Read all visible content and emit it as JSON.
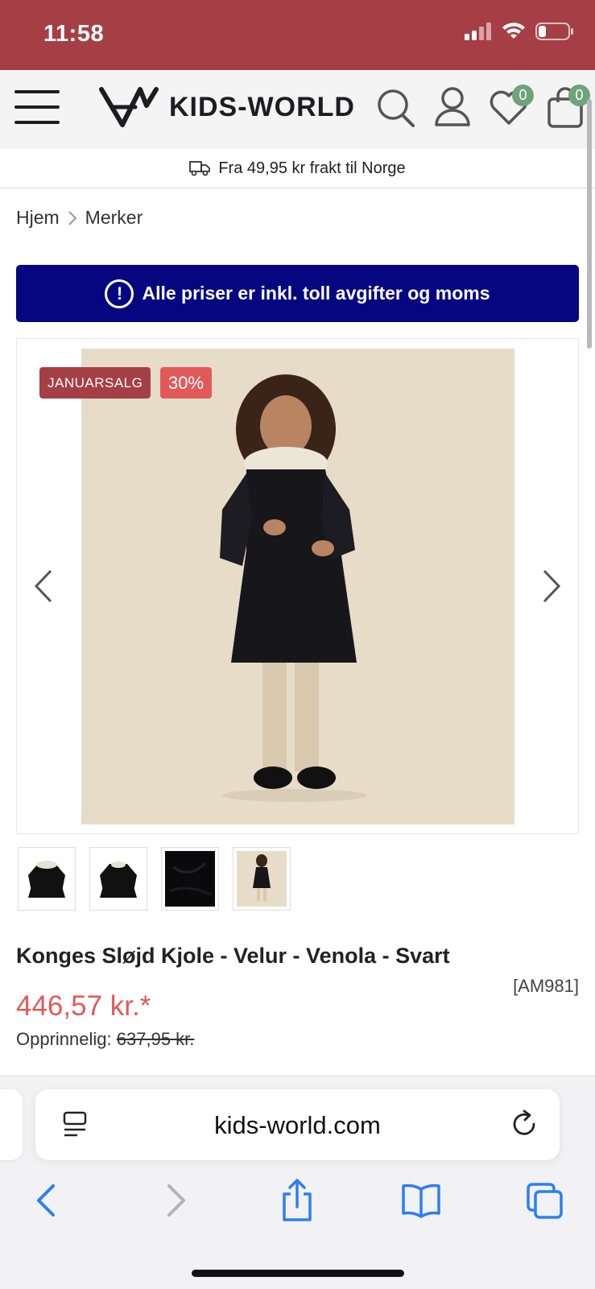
{
  "status": {
    "time": "11:58"
  },
  "header": {
    "logo_text": "KIDS-WORLD",
    "wishlist_count": "0",
    "cart_count": "0"
  },
  "shipping": {
    "text": "Fra 49,95 kr frakt til Norge"
  },
  "breadcrumb": {
    "items": [
      "Hjem",
      "Merker"
    ],
    "separator": ">"
  },
  "notice": {
    "text": "Alle priser er inkl. toll avgifter og moms",
    "icon": "!"
  },
  "gallery": {
    "sale_tag": "JANUARSALG",
    "discount_tag": "30%",
    "thumbnail_count": 4
  },
  "product": {
    "title": "Konges Sløjd Kjole - Velur - Venola - Svart",
    "sku": "[AM981]",
    "price": "446,57 kr.*",
    "original_label": "Opprinnelig:",
    "original_price": "637,95 kr."
  },
  "browser": {
    "url": "kids-world.com"
  },
  "colors": {
    "status_bar": "#a53f45",
    "notice_bg": "#050680",
    "price": "#e2595a",
    "sale_tag": "#a53f45",
    "discount_tag": "#e2595a",
    "badge": "#6fa37a",
    "ios_blue": "#2b7ef6"
  }
}
